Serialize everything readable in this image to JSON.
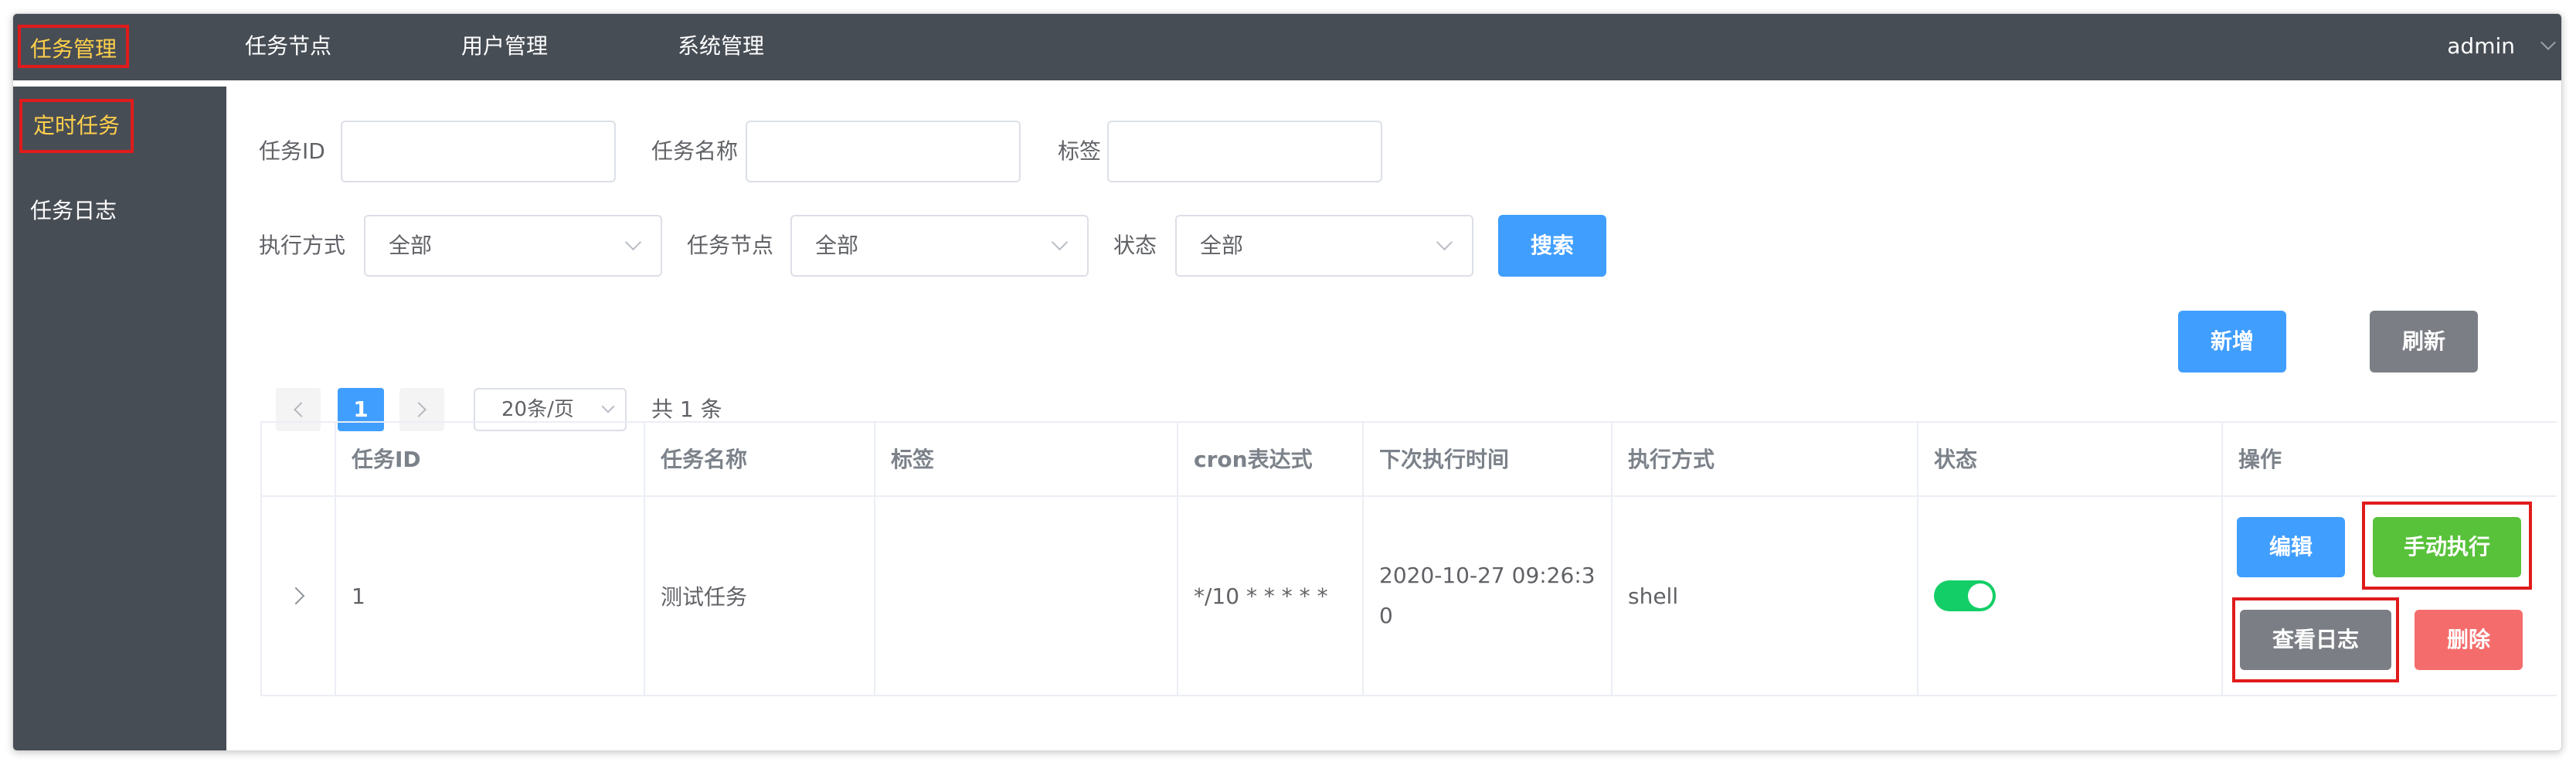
{
  "nav": {
    "items": [
      {
        "label": "任务管理",
        "active": true
      },
      {
        "label": "任务节点"
      },
      {
        "label": "用户管理"
      },
      {
        "label": "系统管理"
      }
    ],
    "user": "admin"
  },
  "sidebar": {
    "items": [
      {
        "label": "定时任务",
        "active": true
      },
      {
        "label": "任务日志"
      }
    ]
  },
  "filters": {
    "task_id_label": "任务ID",
    "task_name_label": "任务名称",
    "tag_label": "标签",
    "exec_mode_label": "执行方式",
    "exec_mode_value": "全部",
    "node_label": "任务节点",
    "node_value": "全部",
    "status_label": "状态",
    "status_value": "全部",
    "search_button": "搜索"
  },
  "toolbar": {
    "add_button": "新增",
    "refresh_button": "刷新"
  },
  "pagination": {
    "current_page": "1",
    "page_size": "20条/页",
    "total": "共 1 条"
  },
  "table": {
    "columns": [
      "任务ID",
      "任务名称",
      "标签",
      "cron表达式",
      "下次执行时间",
      "执行方式",
      "状态",
      "操作"
    ],
    "rows": [
      {
        "id": "1",
        "name": "测试任务",
        "tag": "",
        "cron": "*/10 * * * * *",
        "next_run_line1": "2020-10-27 09:26:3",
        "next_run_line2": "0",
        "exec_mode": "shell",
        "status_on": true
      }
    ],
    "actions": {
      "edit": "编辑",
      "run": "手动执行",
      "log": "查看日志",
      "delete": "删除"
    }
  },
  "colors": {
    "topbar": "#474d55",
    "active": "#ffd04b",
    "primary": "#409eff",
    "success": "#58c23a",
    "danger": "#f56c6c",
    "info": "#7b7f85",
    "highlight": "#e01b1b"
  }
}
